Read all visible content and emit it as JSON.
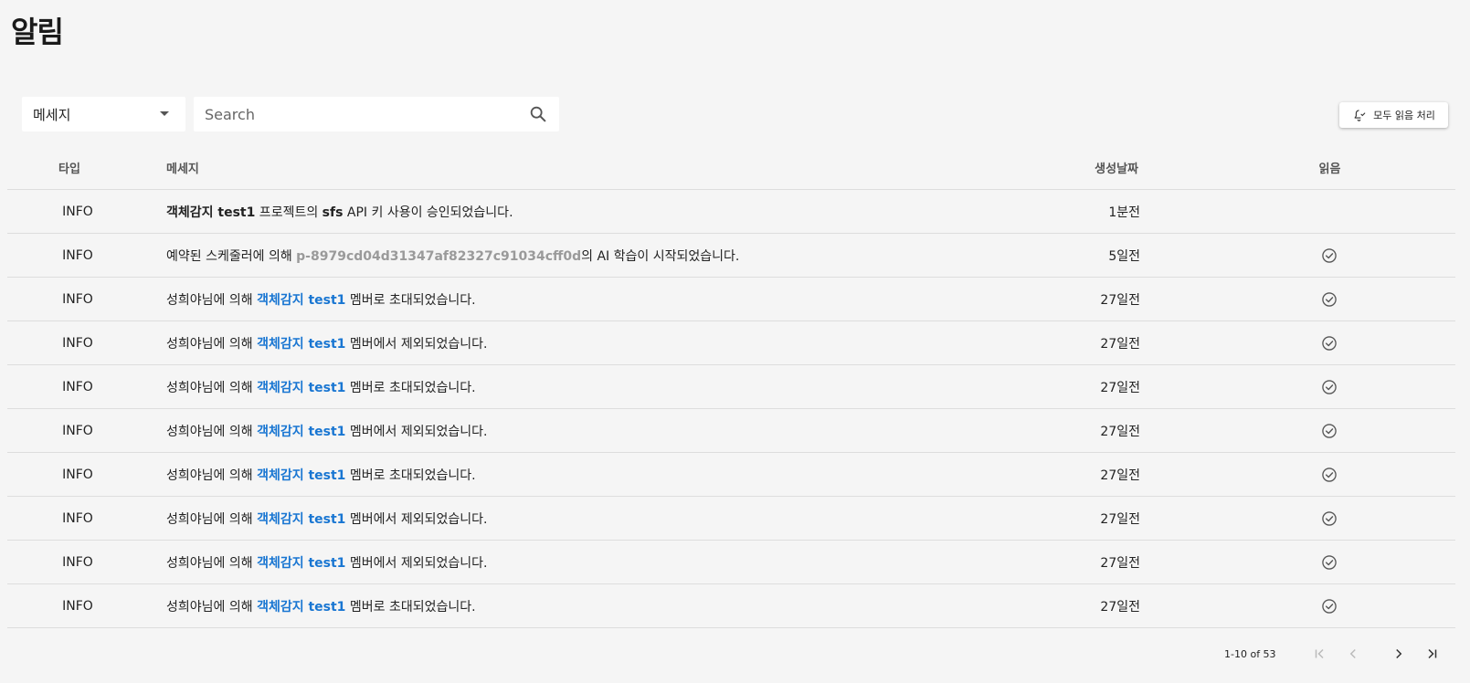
{
  "page": {
    "title": "알림"
  },
  "toolbar": {
    "filter_value": "메세지",
    "search_placeholder": "Search",
    "search_value": "",
    "mark_all_label": "모두 읽음 처리"
  },
  "table": {
    "headers": {
      "type": "타입",
      "message": "메세지",
      "date": "생성날짜",
      "read": "읽음"
    },
    "rows": [
      {
        "type": "INFO",
        "msg": [
          {
            "t": "객체감지 test1",
            "s": "bold"
          },
          {
            "t": " 프로젝트의 ",
            "s": ""
          },
          {
            "t": "sfs",
            "s": "bold"
          },
          {
            "t": " API 키 사용이 승인되었습니다.",
            "s": ""
          }
        ],
        "date": "1분전",
        "read": false
      },
      {
        "type": "INFO",
        "msg": [
          {
            "t": "예약된 스케줄러에 의해 ",
            "s": ""
          },
          {
            "t": "p-8979cd04d31347af82327c91034cff0d",
            "s": "grey"
          },
          {
            "t": "의 AI 학습이 시작되었습니다.",
            "s": ""
          }
        ],
        "date": "5일전",
        "read": true
      },
      {
        "type": "INFO",
        "msg": [
          {
            "t": "성희야님에 의해 ",
            "s": ""
          },
          {
            "t": "객체감지 test1",
            "s": "link"
          },
          {
            "t": " 멤버로 초대되었습니다.",
            "s": ""
          }
        ],
        "date": "27일전",
        "read": true
      },
      {
        "type": "INFO",
        "msg": [
          {
            "t": "성희야님에 의해 ",
            "s": ""
          },
          {
            "t": "객체감지 test1",
            "s": "link"
          },
          {
            "t": " 멤버에서 제외되었습니다.",
            "s": ""
          }
        ],
        "date": "27일전",
        "read": true
      },
      {
        "type": "INFO",
        "msg": [
          {
            "t": "성희야님에 의해 ",
            "s": ""
          },
          {
            "t": "객체감지 test1",
            "s": "link"
          },
          {
            "t": " 멤버로 초대되었습니다.",
            "s": ""
          }
        ],
        "date": "27일전",
        "read": true
      },
      {
        "type": "INFO",
        "msg": [
          {
            "t": "성희야님에 의해 ",
            "s": ""
          },
          {
            "t": "객체감지 test1",
            "s": "link"
          },
          {
            "t": " 멤버에서 제외되었습니다.",
            "s": ""
          }
        ],
        "date": "27일전",
        "read": true
      },
      {
        "type": "INFO",
        "msg": [
          {
            "t": "성희야님에 의해 ",
            "s": ""
          },
          {
            "t": "객체감지 test1",
            "s": "link"
          },
          {
            "t": " 멤버로 초대되었습니다.",
            "s": ""
          }
        ],
        "date": "27일전",
        "read": true
      },
      {
        "type": "INFO",
        "msg": [
          {
            "t": "성희야님에 의해 ",
            "s": ""
          },
          {
            "t": "객체감지 test1",
            "s": "link"
          },
          {
            "t": " 멤버에서 제외되었습니다.",
            "s": ""
          }
        ],
        "date": "27일전",
        "read": true
      },
      {
        "type": "INFO",
        "msg": [
          {
            "t": "성희야님에 의해 ",
            "s": ""
          },
          {
            "t": "객체감지 test1",
            "s": "link"
          },
          {
            "t": " 멤버에서 제외되었습니다.",
            "s": ""
          }
        ],
        "date": "27일전",
        "read": true
      },
      {
        "type": "INFO",
        "msg": [
          {
            "t": "성희야님에 의해 ",
            "s": ""
          },
          {
            "t": "객체감지 test1",
            "s": "link"
          },
          {
            "t": " 멤버로 초대되었습니다.",
            "s": ""
          }
        ],
        "date": "27일전",
        "read": true
      }
    ]
  },
  "pagination": {
    "range_label": "1-10 of 53"
  },
  "icons": {
    "filter_caret": "caret-down-icon",
    "search": "search-icon",
    "mark_all": "bell-check-icon",
    "read": "check-circle-icon",
    "first": "first-page-icon",
    "prev": "chevron-left-icon",
    "next": "chevron-right-icon",
    "last": "last-page-icon"
  },
  "colors": {
    "link": "#1976d2",
    "muted_id": "#9a9a9a",
    "background": "#f5f5f5"
  }
}
